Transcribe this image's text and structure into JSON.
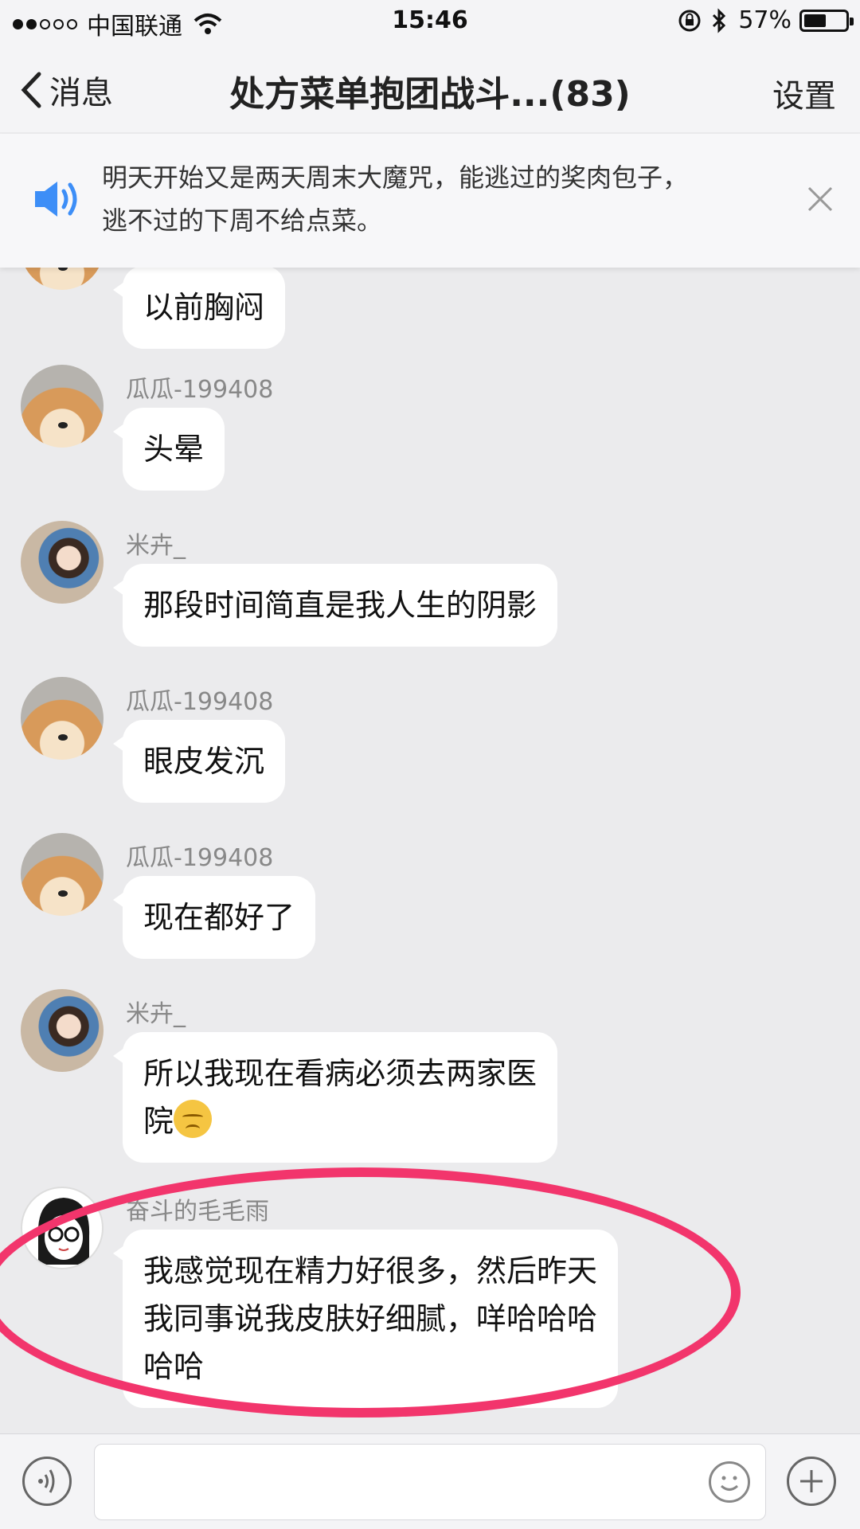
{
  "status_bar": {
    "carrier": "中国联通",
    "time": "15:46",
    "battery": "57%",
    "battery_level": 0.57,
    "icons": [
      "signal-dots-icon",
      "wifi-icon",
      "rotation-lock-icon",
      "bluetooth-icon",
      "battery-icon"
    ]
  },
  "nav": {
    "back_label": "消息",
    "title": "处方菜单抱团战斗...(83)",
    "settings_label": "设置"
  },
  "notice": {
    "line1": "明天开始又是两天周末大魔咒，能逃过的奖肉包子，",
    "line2": "逃不过的下周不给点菜。",
    "icons": [
      "speaker-icon",
      "close-icon"
    ]
  },
  "messages": [
    {
      "avatar": "dog",
      "sender": "",
      "text": "以前胸闷"
    },
    {
      "avatar": "dog",
      "sender": "瓜瓜-199408",
      "text": "头晕"
    },
    {
      "avatar": "girl",
      "sender": "米卉_",
      "text": "那段时间简直是我人生的阴影"
    },
    {
      "avatar": "dog",
      "sender": "瓜瓜-199408",
      "text": "眼皮发沉"
    },
    {
      "avatar": "dog",
      "sender": "瓜瓜-199408",
      "text": "现在都好了"
    },
    {
      "avatar": "girl",
      "sender": "米卉_",
      "line1": "所以我现在看病必须去两家医",
      "line2": "院",
      "emoji": "disappointed-face-emoji"
    },
    {
      "avatar": "cartoon",
      "sender": "奋斗的毛毛雨",
      "line1": "我感觉现在精力好很多，然后昨天",
      "line2": "我同事说我皮肤好细腻，咩哈哈哈",
      "line3": "哈哈"
    }
  ],
  "input": {
    "placeholder": "",
    "icons": [
      "voice-icon",
      "emoji-icon",
      "plus-icon"
    ]
  },
  "colors": {
    "highlight_ring": "#f2356c",
    "speaker": "#3d8ef7",
    "background": "#ebebed"
  }
}
